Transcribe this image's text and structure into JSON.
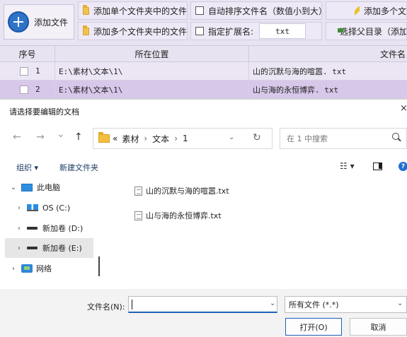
{
  "app": {
    "add_file_label": "添加文件",
    "add_single_folder_label": "添加单个文件夹中的文件",
    "add_multi_folder_label": "添加多个文件夹中的文件",
    "auto_sort_label": "自动排序文件名（数值小到大）",
    "ext_filter_label": "指定扩展名:",
    "ext_filter_value": "txt",
    "add_multi_right_label": "添加多个文",
    "choose_parent_label": "选择父目录（添加",
    "columns": [
      "序号",
      "所在位置",
      "文件名"
    ],
    "rows": [
      {
        "num": "1",
        "location": "E:\\素材\\文本\\1\\",
        "filename": "山的沉默与海的喧嚣. txt"
      },
      {
        "num": "2",
        "location": "E:\\素材\\文本\\1\\",
        "filename": "山与海的永恒博弈. txt"
      }
    ]
  },
  "dialog": {
    "title": "请选择要编辑的文档",
    "close_glyph": "×",
    "nav": {
      "back": "←",
      "forward": "→",
      "recent": "⌄",
      "up": "↑"
    },
    "breadcrumb": {
      "prefix": "«",
      "items": [
        "素材",
        "文本",
        "1"
      ],
      "separator": "›"
    },
    "refresh_glyph": "↻",
    "search_placeholder": "在 1 中搜索",
    "organize_label": "组织 ▾",
    "new_folder_label": "新建文件夹",
    "view_glyph": "☷ ▾",
    "tree": [
      {
        "label": "此电脑",
        "chevron": "⌄",
        "icon": "pc-icon"
      },
      {
        "label": "OS (C:)",
        "chevron": "›",
        "icon": "os-drive-icon"
      },
      {
        "label": "新加卷 (D:)",
        "chevron": "›",
        "icon": "drive-icon"
      },
      {
        "label": "新加卷 (E:)",
        "chevron": "›",
        "icon": "drive-icon",
        "selected": true
      },
      {
        "label": "网络",
        "chevron": "›",
        "icon": "network-icon"
      }
    ],
    "files": [
      "山的沉默与海的喧嚣.txt",
      "山与海的永恒博弈.txt"
    ],
    "filename_label": "文件名(N):",
    "filename_value": "",
    "filetype_value": "所有文件 (*.*)",
    "open_label": "打开(O)",
    "cancel_label": "取消"
  },
  "colors": {
    "accent": "#1f5fb8",
    "selected_row": "#d7c8ea",
    "toolbar_bg": "#e9e4f2"
  }
}
